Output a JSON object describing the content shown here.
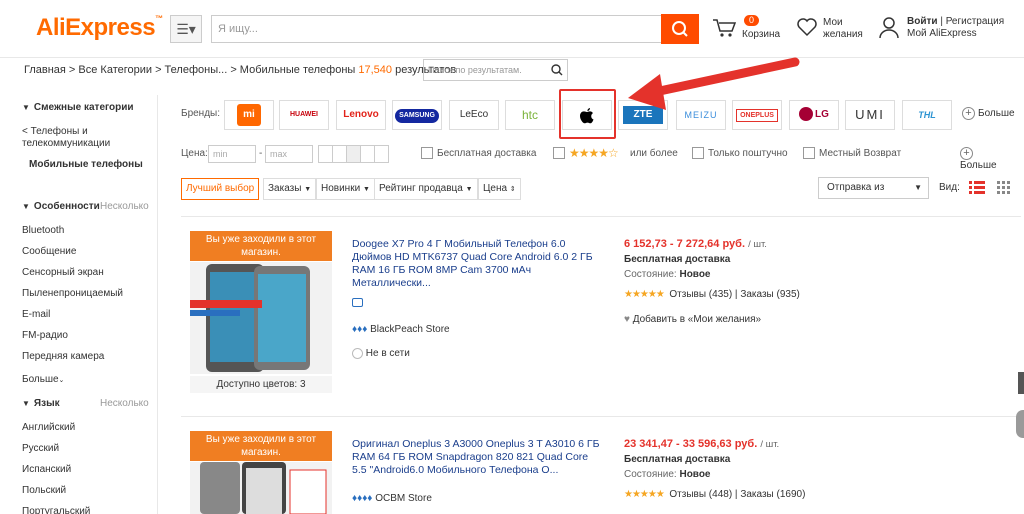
{
  "header": {
    "logo": "AliExpress",
    "logo_tm": "™",
    "menu_glyph": "☰▾",
    "search_placeholder": "Я ищу...",
    "cart_count": "0",
    "cart_label": "Корзина",
    "wishlist_line1": "Мои",
    "wishlist_line2": "желания",
    "login_label": "Войти",
    "divider": "|",
    "register_label": "Регистрация",
    "my_aliexpress": "Мой AliExpress"
  },
  "breadcrumb": {
    "path": "Главная > Все Категории > Телефоны... > Мобильные телефоны",
    "count": "17,540",
    "results_label": "результатов",
    "search_placeholder": "Поиск по результатам."
  },
  "sidebar": {
    "related_title": "Смежные категории",
    "parent_category_line1": "< Телефоны и",
    "parent_category_line2": "телекоммуникации",
    "current_category": "Мобильные телефоны",
    "features_title": "Особенности",
    "features_more": "Несколько",
    "features": [
      "Bluetooth",
      "Сообщение",
      "Сенсорный экран",
      "Пыленепроницаемый",
      "E-mail",
      "FM-радио",
      "Передняя камера"
    ],
    "show_more": "Больше",
    "language_title": "Язык",
    "language_more": "Несколько",
    "languages": [
      "Английский",
      "Русский",
      "Испанский",
      "Польский",
      "Португальский"
    ]
  },
  "brands": {
    "label": "Бренды:",
    "items": [
      "mi",
      "HUAWEI",
      "Lenovo",
      "SAMSUNG",
      "LeEco",
      "htc",
      "",
      "ZTE",
      "MEIZU",
      "ONEPLUS",
      "LG",
      "UMI",
      "THL"
    ],
    "more": "Больше"
  },
  "filters": {
    "price_label": "Цена:",
    "min_placeholder": "min",
    "dash": "-",
    "max_placeholder": "max",
    "free_shipping": "Бесплатная доставка",
    "rating_stars": "★★★★☆",
    "rating_suffix": "или более",
    "single_piece": "Только поштучно",
    "local_return": "Местный Возврат",
    "more": "Больше"
  },
  "sort": {
    "best": "Лучший выбор",
    "orders": "Заказы",
    "newest": "Новинки",
    "seller_rating": "Рейтинг продавца",
    "price": "Цена",
    "ship_from": "Отправка из",
    "view_label": "Вид:"
  },
  "products": [
    {
      "banner": "Вы уже заходили в этот магазин.",
      "title": "Doogee X7 Pro 4 Г Мобильный Телефон 6.0 Дюймов HD MTK6737 Quad Core Android 6.0 2 ГБ RAM 16 ГБ ROM 8MP Cam 3700 мАч Металлически...",
      "store": "BlackPeach Store",
      "online": "Не в сети",
      "colors": "Доступно цветов: 3",
      "price": "6 152,73 - 7 272,64 руб.",
      "unit": "/ шт.",
      "shipping": "Бесплатная доставка",
      "condition_label": "Состояние:",
      "condition": "Новое",
      "stars": "★★★★★",
      "reviews": "Отзывы (435)",
      "orders": "Заказы (935)",
      "wishlist": "Добавить в «Мои желания»"
    },
    {
      "banner": "Вы уже заходили в этот магазин.",
      "title": "Оригинал Oneplus 3 A3000 Oneplus 3 T A3010 6 ГБ RAM 64 ГБ ROM Snapdragon 820 821 Quad Core 5.5 \"Android6.0 Мобильного Телефона О...",
      "store": "OCBM Store",
      "price": "23 341,47 - 33 596,63 руб.",
      "unit": "/ шт.",
      "shipping": "Бесплатная доставка",
      "condition_label": "Состояние:",
      "condition": "Новое",
      "stars": "★★★★★",
      "reviews": "Отзывы (448)",
      "orders": "Заказы (1690)"
    }
  ],
  "colors": {
    "brand_orange": "#ff6a00",
    "search_button": "#ff4b00",
    "price_red": "#e4322b",
    "highlight": "#e4322b",
    "banner_orange": "#f07e22"
  }
}
